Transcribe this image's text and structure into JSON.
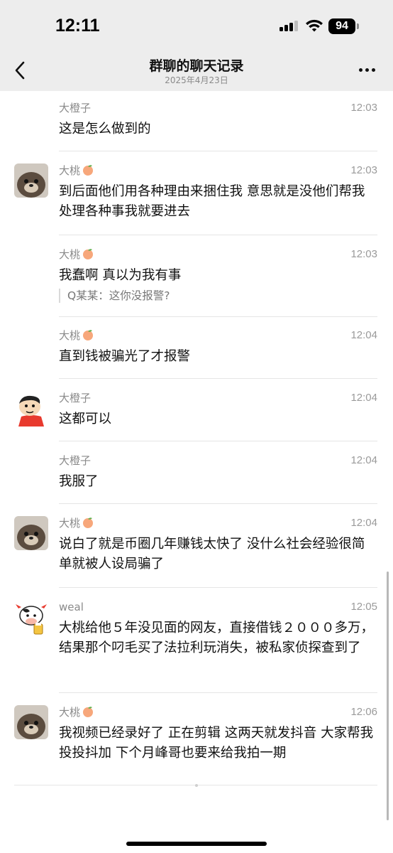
{
  "status_bar": {
    "time": "12:11",
    "battery": "94",
    "icons": [
      "cellular-signal-icon",
      "wifi-icon",
      "battery-icon"
    ]
  },
  "nav": {
    "title": "群聊的聊天记录",
    "subtitle": "2025年4月23日",
    "back_icon": "chevron-left-icon",
    "more_icon": "more-dots-icon"
  },
  "messages": [
    {
      "sender": "大橙子",
      "peach": false,
      "time": "12:03",
      "text": "这是怎么做到的",
      "avatar": "none"
    },
    {
      "sender": "大桃",
      "peach": true,
      "time": "12:03",
      "text": "到后面他们用各种理由来捆住我 意思就是没他们帮我处理各种事我就要进去",
      "avatar": "otter"
    },
    {
      "sender": "大桃",
      "peach": true,
      "time": "12:03",
      "text": "我蠢啊 真以为我有事",
      "quote": "Q某某：这你没报警?",
      "avatar": "none"
    },
    {
      "sender": "大桃",
      "peach": true,
      "time": "12:04",
      "text": "直到钱被骗光了才报警",
      "avatar": "none"
    },
    {
      "sender": "大橙子",
      "peach": false,
      "time": "12:04",
      "text": "这都可以",
      "avatar": "cartoon-boy"
    },
    {
      "sender": "大橙子",
      "peach": false,
      "time": "12:04",
      "text": "我服了",
      "avatar": "none"
    },
    {
      "sender": "大桃",
      "peach": true,
      "time": "12:04",
      "text": "说白了就是币圈几年赚钱太快了 没什么社会经验很简单就被人设局骗了",
      "avatar": "otter"
    },
    {
      "sender": "weal",
      "peach": false,
      "time": "12:05",
      "text": "大桃给他５年没见面的网友，直接借钱２０００多万，结果那个叼毛买了法拉利玩消失，被私家侦探查到了",
      "avatar": "cow"
    },
    {
      "sender": "大桃",
      "peach": true,
      "time": "12:06",
      "text": "我视频已经录好了 正在剪辑 这两天就发抖音 大家帮我投投抖加 下个月峰哥也要来给我拍一期",
      "avatar": "otter"
    }
  ],
  "colors": {
    "header_bg": "#ededed",
    "divider": "#e5e5e5",
    "meta_text": "#8a8a8a"
  }
}
